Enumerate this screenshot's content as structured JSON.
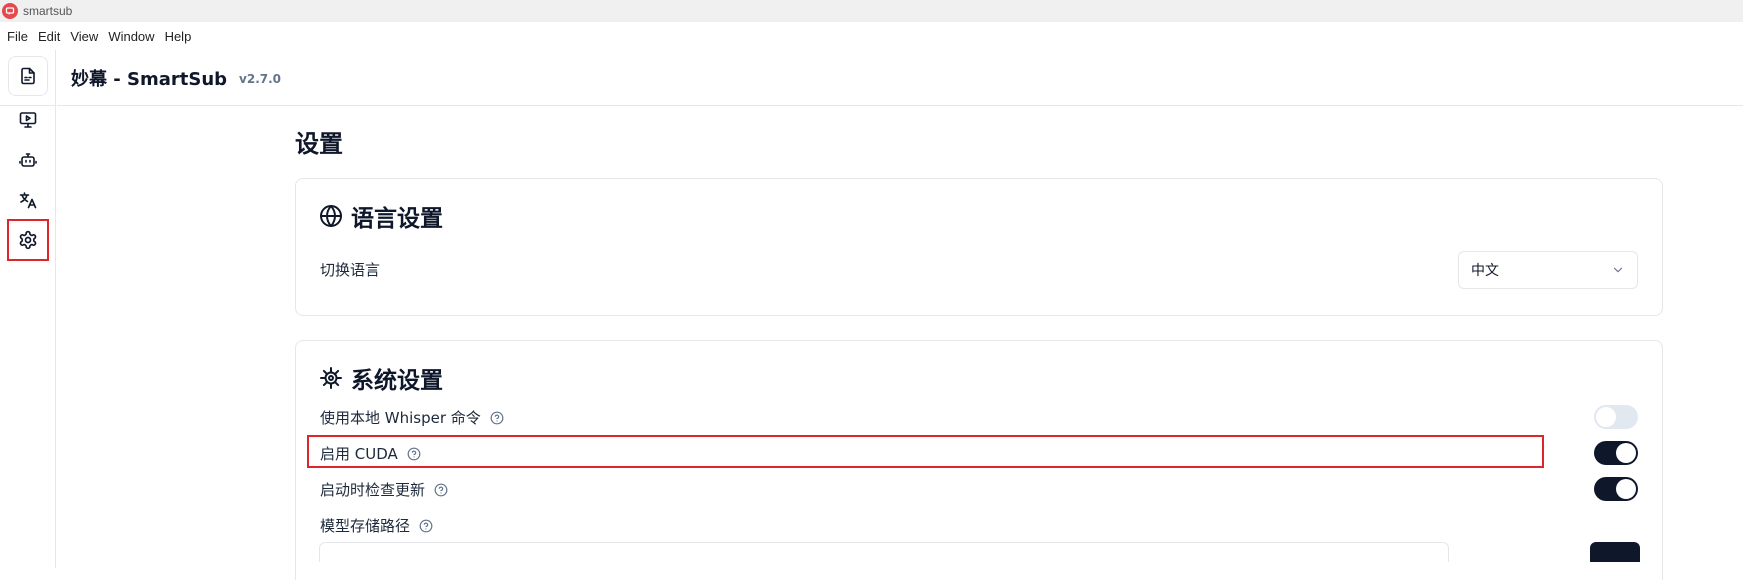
{
  "window": {
    "title": "smartsub"
  },
  "menu": [
    "File",
    "Edit",
    "View",
    "Window",
    "Help"
  ],
  "header": {
    "title": "妙幕 - SmartSub",
    "version": "v2.7.0"
  },
  "sidebar": {
    "items": [
      {
        "icon": "subtitle-file-icon"
      },
      {
        "icon": "video-play-icon"
      },
      {
        "icon": "bot-icon"
      },
      {
        "icon": "translate-icon"
      },
      {
        "icon": "gear-icon",
        "active": true
      }
    ]
  },
  "page": {
    "title": "设置"
  },
  "language": {
    "title": "语言设置",
    "switch_label": "切换语言",
    "selected": "中文"
  },
  "system": {
    "title": "系统设置",
    "items": [
      {
        "label": "使用本地 Whisper 命令",
        "enabled": false
      },
      {
        "label": "启用 CUDA",
        "enabled": true
      },
      {
        "label": "启动时检查更新",
        "enabled": true
      },
      {
        "label": "模型存储路径"
      }
    ]
  },
  "colors": {
    "accent": "#0f172a",
    "highlight": "#e0242c",
    "logo": "#e5484d"
  }
}
